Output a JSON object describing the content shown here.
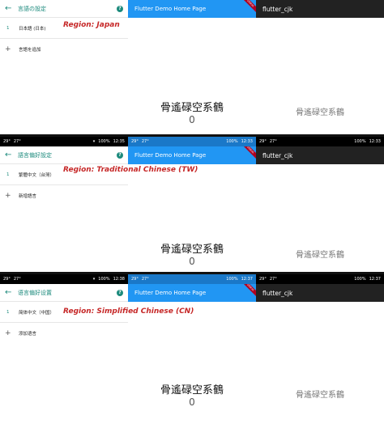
{
  "common": {
    "flutter_title": "Flutter Demo Home Page",
    "cjk_app_title": "flutter_cjk",
    "cjk_sample": "骨遙碌空系鶴",
    "counter": "0",
    "debug_banner": "DEBUG",
    "status": {
      "temp": "29°",
      "temp2": "27°",
      "battery": "100%"
    }
  },
  "rows": [
    {
      "settings_title": "言語の設定",
      "lang_index": "1",
      "lang_name": "日本語 (日本)",
      "add_label": "言語を追加",
      "region_label": "Region: Japan",
      "time_left": "",
      "time_right": ""
    },
    {
      "settings_title": "語言偏好設定",
      "lang_index": "1",
      "lang_name": "繁體中文（台灣）",
      "add_label": "新增語言",
      "region_label": "Region: Traditional Chinese (TW)",
      "time_left": "12:35",
      "time_right": "12:33"
    },
    {
      "settings_title": "语言偏好设置",
      "lang_index": "1",
      "lang_name": "简体中文（中国）",
      "add_label": "添加语言",
      "region_label": "Region: Simplified Chinese (CN)",
      "time_left": "12:38",
      "time_right": "12:37"
    }
  ]
}
